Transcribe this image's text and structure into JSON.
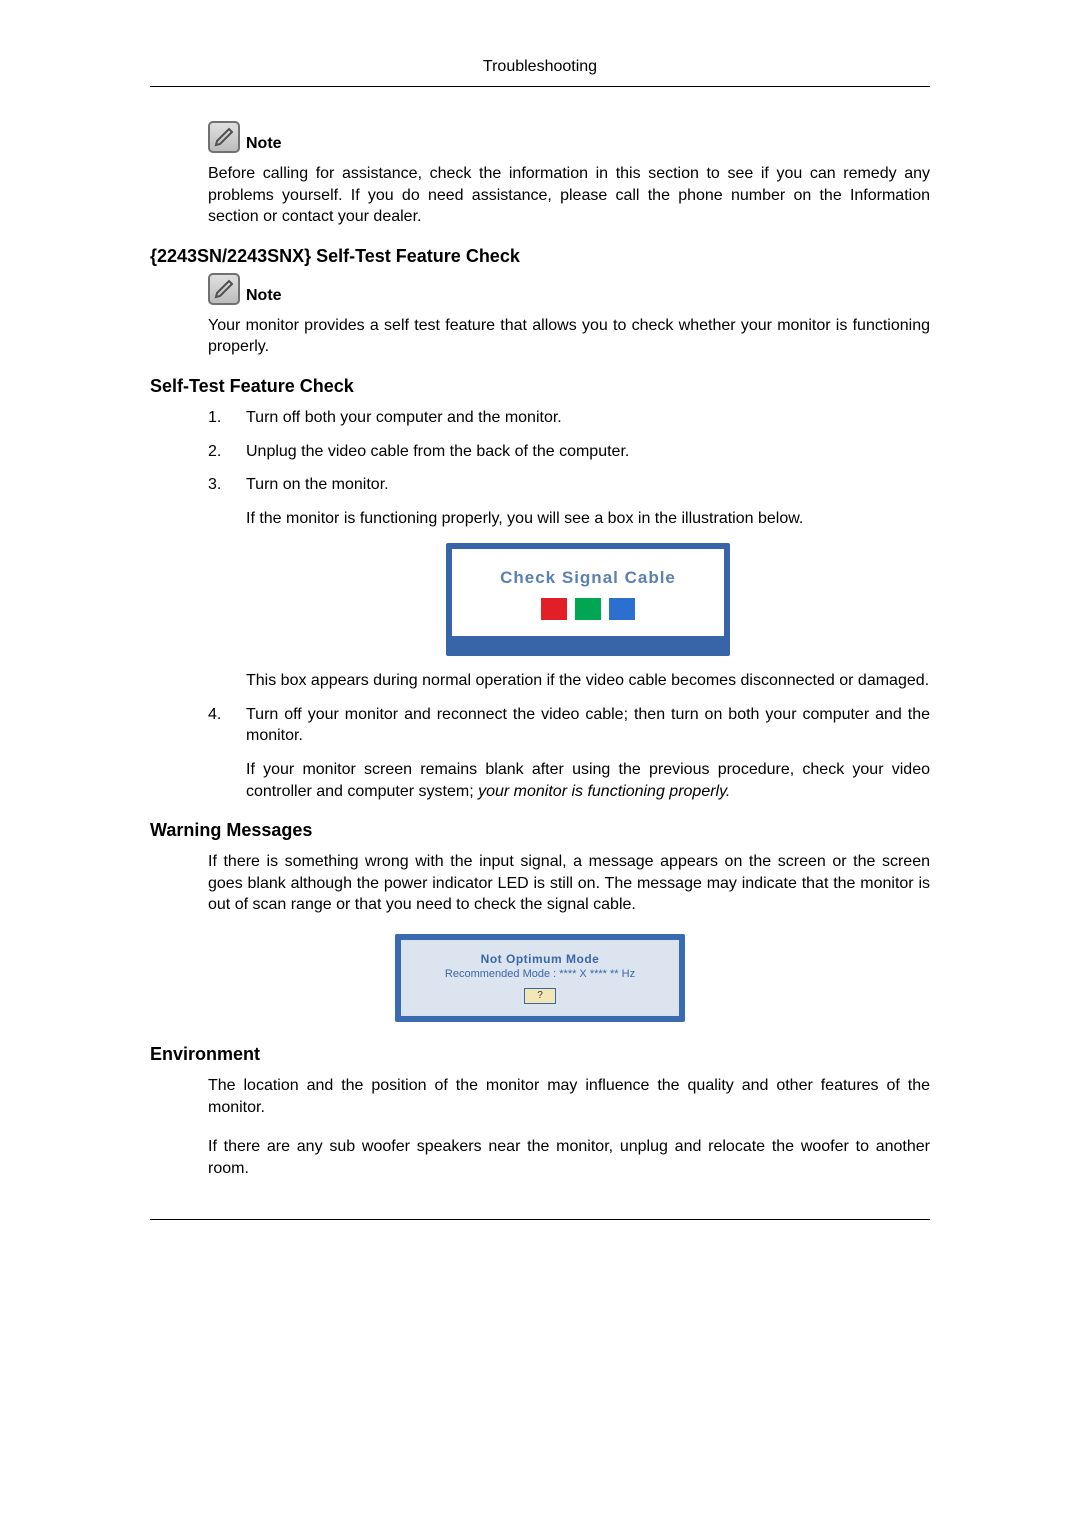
{
  "header": {
    "title": "Troubleshooting"
  },
  "note1": {
    "label": "Note",
    "text": "Before calling for assistance, check the information in this section to see if you can remedy any problems yourself. If you do need assistance, please call the phone number on the Information section or contact your dealer."
  },
  "section1": {
    "heading": "{2243SN/2243SNX} Self-Test Feature Check",
    "note_label": "Note",
    "note_text": "Your monitor provides a self test feature that allows you to check whether your monitor is functioning properly."
  },
  "section2": {
    "heading": "Self-Test Feature Check",
    "steps": {
      "s1": "Turn off both your computer and the monitor.",
      "s2": "Unplug the video cable from the back of the computer.",
      "s3": "Turn on the monitor.",
      "s3_para": "If the monitor is functioning properly, you will see a box in the illustration below.",
      "s3_box_text": "Check Signal Cable",
      "s3_after": "This box appears during normal operation if the video cable becomes disconnected or damaged.",
      "s4": "Turn off your monitor and reconnect the video cable; then turn on both your computer and the monitor.",
      "s4_para_a": "If your monitor screen remains blank after using the previous procedure, check your video controller and computer system; ",
      "s4_para_em": "your monitor is functioning properly."
    }
  },
  "warning": {
    "heading": "Warning Messages",
    "text": "If there is something wrong with the input signal, a message appears on the screen or the screen goes blank although the power indicator LED is still on. The message may indicate that the monitor is out of scan range or that you need to check the signal cable.",
    "box_line1": "Not Optimum Mode",
    "box_line2": "Recommended Mode : **** X **** ** Hz",
    "box_btn": "?"
  },
  "env": {
    "heading": "Environment",
    "p1": "The location and the position of the monitor may influence the quality and other features of the monitor.",
    "p2": "If there are any sub woofer speakers near the monitor, unplug and relocate the woofer to another room."
  }
}
